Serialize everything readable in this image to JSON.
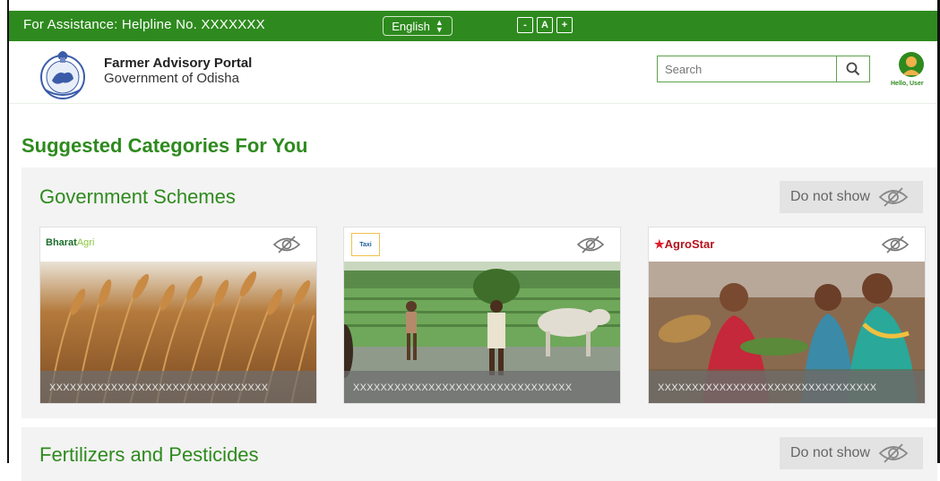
{
  "topbar": {
    "helpline": "For Assistance: Helpline No. XXXXXXX",
    "language": "English",
    "font_decrease": "-",
    "font_normal": "A",
    "font_increase": "+"
  },
  "header": {
    "portal_title": "Farmer Advisory Portal",
    "portal_subtitle": "Government of Odisha",
    "search_placeholder": "Search",
    "greeting": "Hello, User"
  },
  "main": {
    "section_heading": "Suggested Categories For You",
    "categories": [
      {
        "title": "Government Schemes",
        "hide_label": "Do not show",
        "cards": [
          {
            "brand": "BharatAgri",
            "brand_part1": "Bharat",
            "brand_part2": "Agri",
            "caption": "XXXXXXXXXXXXXXXXXXXXXXXXXXXXXXXX"
          },
          {
            "brand": "Taxi",
            "caption": "XXXXXXXXXXXXXXXXXXXXXXXXXXXXXXXX"
          },
          {
            "brand": "AgroStar",
            "caption": "XXXXXXXXXXXXXXXXXXXXXXXXXXXXXXXX"
          }
        ]
      },
      {
        "title": "Fertilizers and Pesticides",
        "hide_label": "Do not show"
      }
    ]
  },
  "colors": {
    "brand_green": "#2e8a1e",
    "panel_bg": "#f3f3f3"
  },
  "icons": {
    "hide": "eye-off-icon",
    "search": "search-icon",
    "user": "user-icon"
  }
}
